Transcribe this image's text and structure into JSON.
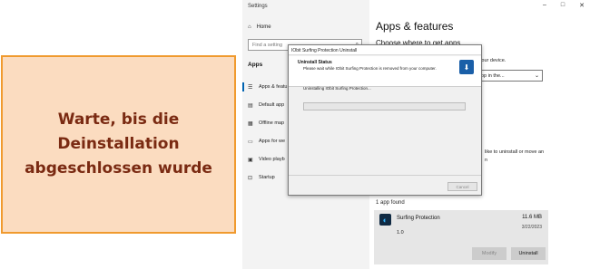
{
  "callout": {
    "text": "Warte, bis die\nDeinstallation\nabgeschlossen wurde"
  },
  "settings": {
    "window_title": "Settings",
    "home_label": "Home",
    "search_placeholder": "Find a setting",
    "section_label": "Apps",
    "nav_items": [
      {
        "label": "Apps & featu",
        "icon": "apps-list-icon"
      },
      {
        "label": "Default app",
        "icon": "default-apps-icon"
      },
      {
        "label": "Offline map",
        "icon": "map-icon"
      },
      {
        "label": "Apps for we",
        "icon": "web-apps-icon"
      },
      {
        "label": "Video playb",
        "icon": "video-icon"
      },
      {
        "label": "Startup",
        "icon": "startup-icon"
      }
    ],
    "window_controls": {
      "minimize": "–",
      "maximize": "□",
      "close": "✕"
    }
  },
  "main": {
    "title": "Apps & features",
    "subtitle_partial": "Choose where to get apps",
    "protect_text": "ps protect your device.",
    "dropdown_value": "parable app in the...",
    "uninstall_hint": "like to uninstall or move an\nn",
    "apps_found": "1 app found",
    "app": {
      "name": "Surfing Protection",
      "size": "11.6 MB",
      "date": "3/22/2023",
      "version": "1.0",
      "modify_label": "Modify",
      "uninstall_label": "Uninstall"
    }
  },
  "dialog": {
    "title": "IObit Surfing Protection Uninstall",
    "status_title": "Uninstall Status",
    "status_desc": "Please wait while IObit Surfing Protection is removed from your computer.",
    "progress_text": "Uninstalling IObit Surfing Protection...",
    "progress_fraction": 0,
    "cancel_label": "Cancel"
  },
  "colors": {
    "callout_bg": "#fbdcc0",
    "callout_border": "#f09a2e",
    "callout_text": "#7a2a12",
    "accent": "#0063b1"
  }
}
